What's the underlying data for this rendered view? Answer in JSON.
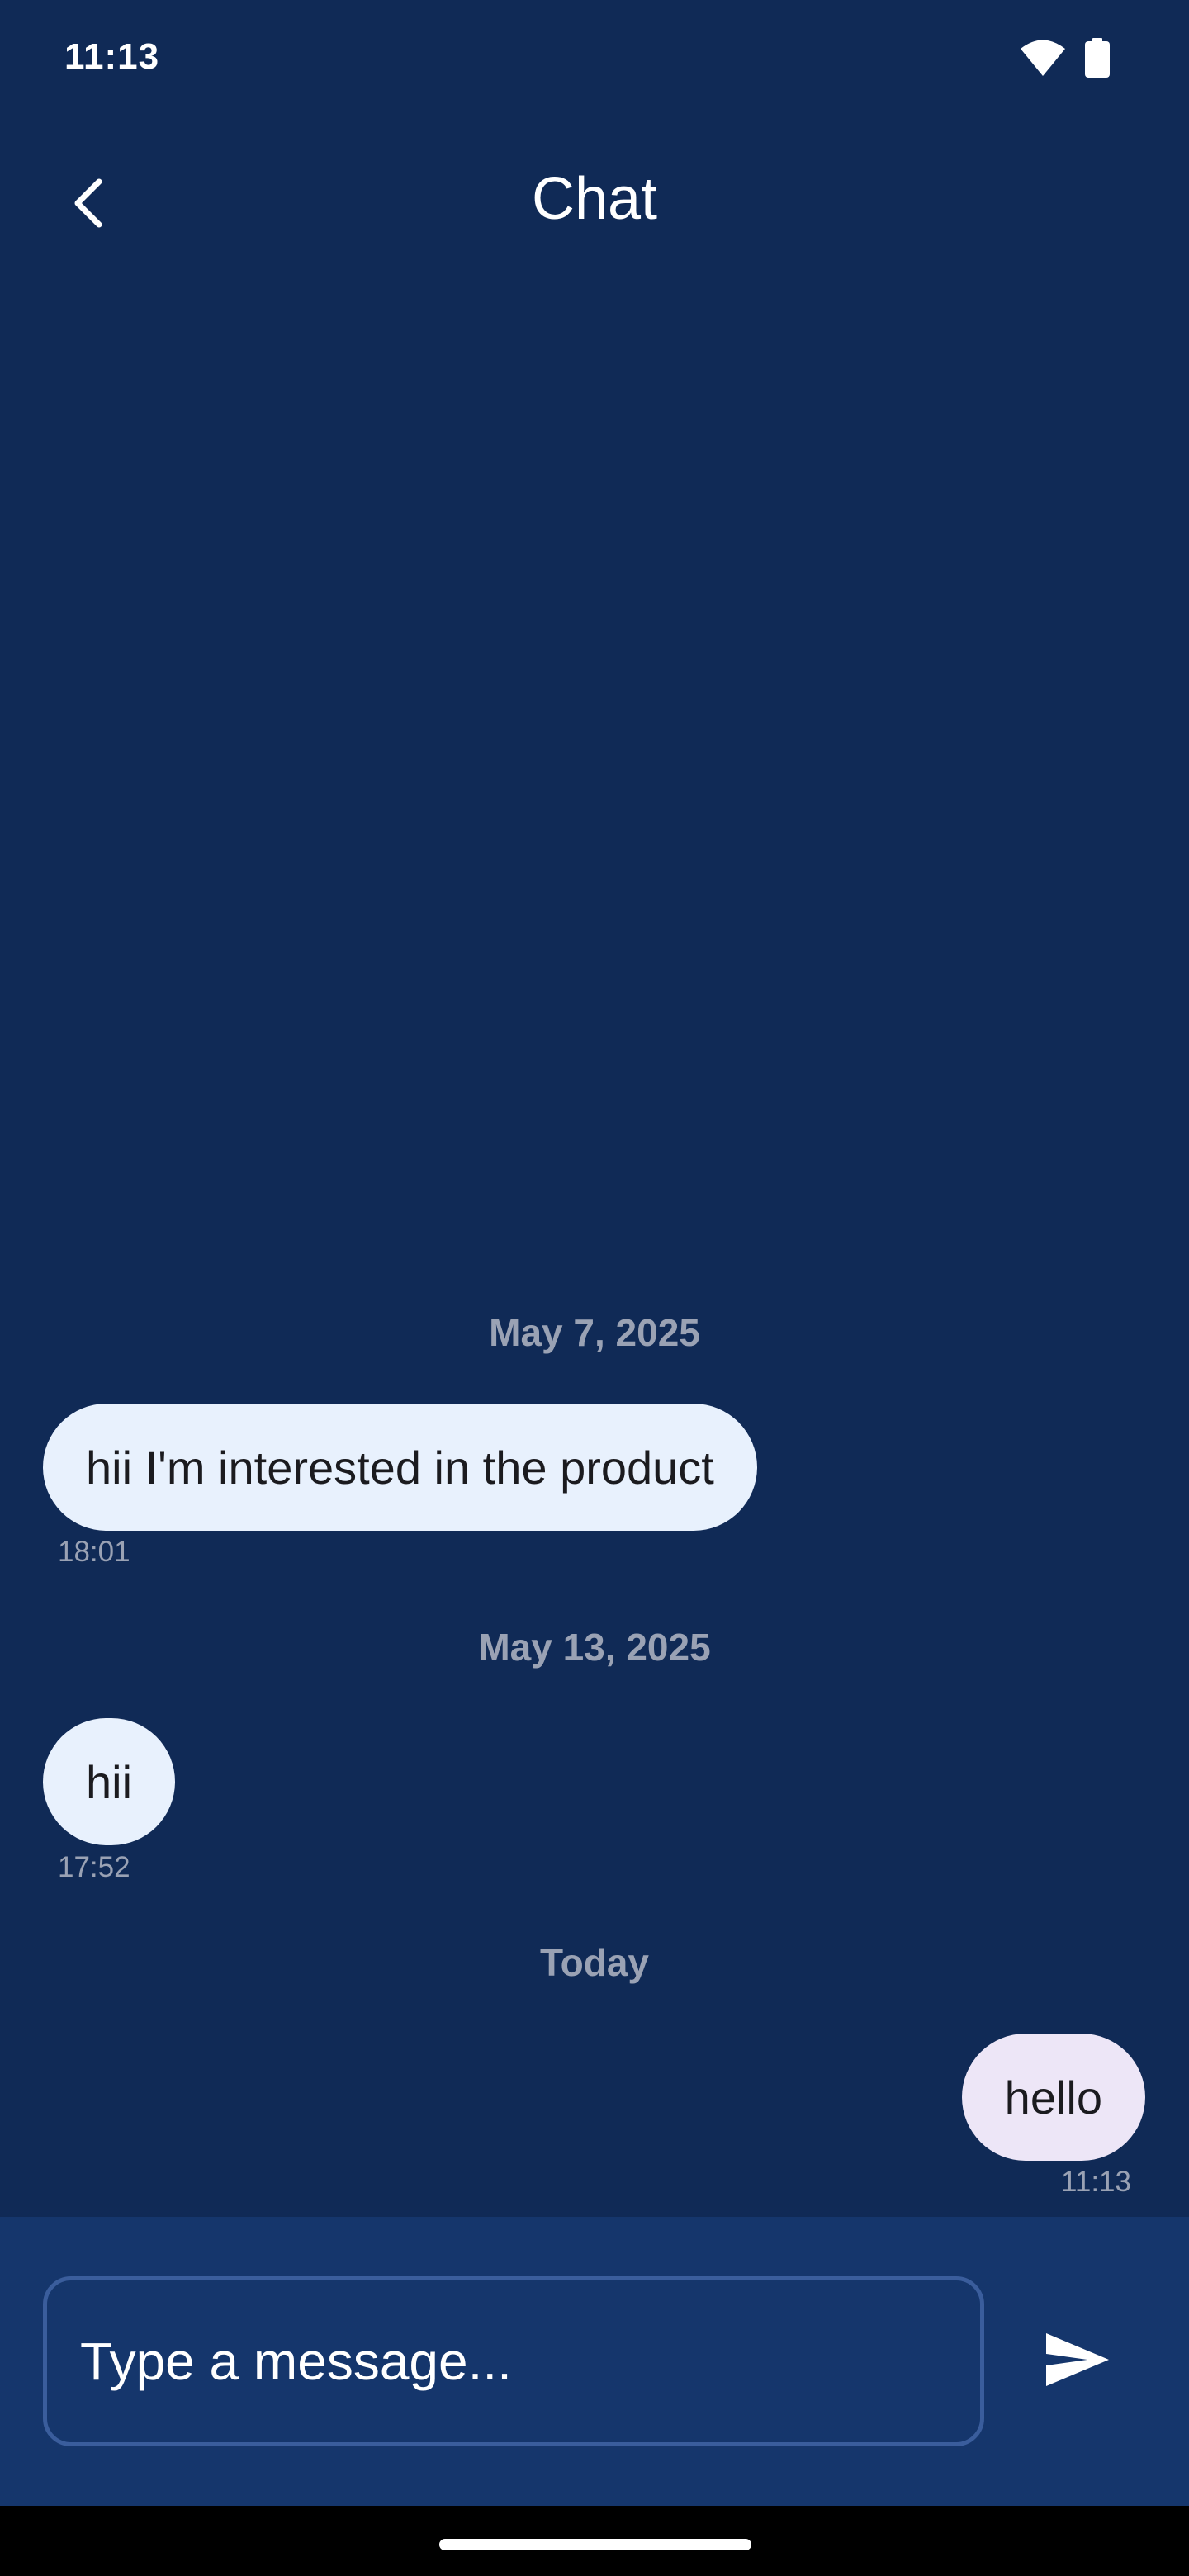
{
  "status_bar": {
    "time": "11:13",
    "icons": [
      "wifi-icon",
      "battery-icon"
    ]
  },
  "header": {
    "title": "Chat",
    "back_icon": "arrow-back-icon"
  },
  "conversation": [
    {
      "type": "date",
      "text": "May 7, 2025"
    },
    {
      "type": "message",
      "direction": "incoming",
      "text": "hii I'm interested in the product",
      "time": "18:01"
    },
    {
      "type": "date",
      "text": "May 13, 2025"
    },
    {
      "type": "message",
      "direction": "incoming",
      "text": "hii",
      "time": "17:52"
    },
    {
      "type": "date",
      "text": "Today"
    },
    {
      "type": "message",
      "direction": "outgoing",
      "text": "hello",
      "time": "11:13"
    }
  ],
  "composer": {
    "placeholder": "Type a message...",
    "value": "",
    "send_icon": "send-icon"
  },
  "colors": {
    "background": "#102a56",
    "composer_background": "#15366c",
    "incoming_bubble": "#e8f1fd",
    "outgoing_bubble": "#ede6f7",
    "muted_text": "#9aa2b4",
    "input_border": "#3a5d9c"
  }
}
